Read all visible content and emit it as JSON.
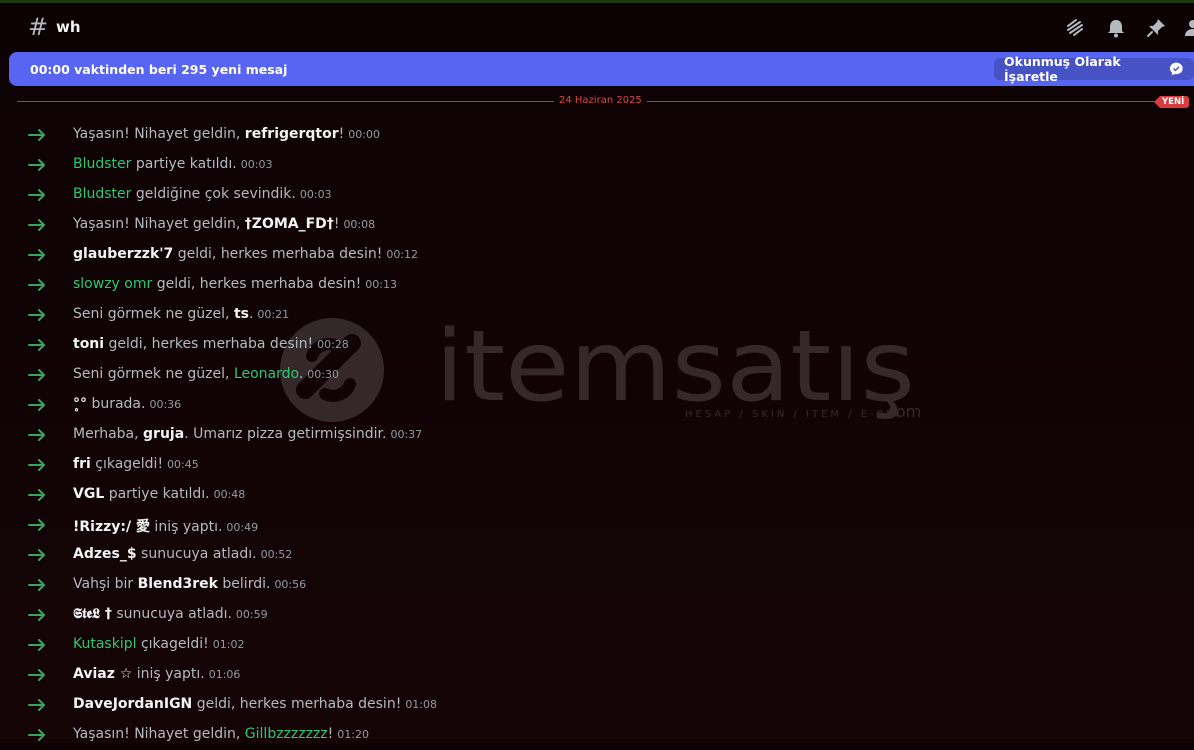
{
  "channel": {
    "name": "wh",
    "hash_icon": "hash-icon"
  },
  "header_icons": [
    "threads-icon",
    "bell-icon",
    "pin-icon",
    "members-icon"
  ],
  "banner": {
    "text": "00:00 vaktinden beri 295 yeni mesaj",
    "mark_read": "Okunmuş Olarak İşaretle",
    "color": "#5865f2"
  },
  "divider": {
    "date": "24 Haziran 2025",
    "badge": "YENİ"
  },
  "watermark": {
    "brand": "itemsatış",
    "tagline": "HESAP / SKIN / ITEM / E-PIN",
    "suffix": ".com"
  },
  "messages": [
    {
      "pre": "Yaşasın! Nihayet geldin, ",
      "user": "refrigerqtor",
      "green": false,
      "post": "!",
      "time": "00:00"
    },
    {
      "pre": "",
      "user": "Bludster",
      "green": true,
      "post": " partiye katıldı.",
      "time": "00:03"
    },
    {
      "pre": "",
      "user": "Bludster",
      "green": true,
      "post": " geldiğine çok sevindik.",
      "time": "00:03"
    },
    {
      "pre": "Yaşasın! Nihayet geldin, ",
      "user": "†ZOMA_FD†",
      "green": false,
      "post": "!",
      "time": "00:08"
    },
    {
      "pre": "",
      "user": "glauberzzk'7",
      "green": false,
      "post": " geldi, herkes merhaba desin!",
      "time": "00:12"
    },
    {
      "pre": "",
      "user": "slowzy omr",
      "green": true,
      "post": " geldi, herkes merhaba desin!",
      "time": "00:13"
    },
    {
      "pre": "Seni görmek ne güzel, ",
      "user": "ts",
      "green": false,
      "post": ".",
      "time": "00:21"
    },
    {
      "pre": "",
      "user": "toni",
      "green": false,
      "post": " geldi, herkes merhaba desin!",
      "time": "00:28"
    },
    {
      "pre": "Seni görmek ne güzel, ",
      "user": "Leonardo",
      "green": true,
      "post": ".",
      "time": "00:30"
    },
    {
      "pre": "",
      "user": "°̥°",
      "green": false,
      "post": " burada.",
      "time": "00:36"
    },
    {
      "pre": "Merhaba, ",
      "user": "gruja",
      "green": false,
      "post": ". Umarız pizza getirmişsindir.",
      "time": "00:37"
    },
    {
      "pre": "",
      "user": "fri",
      "green": false,
      "post": " çıkageldi!",
      "time": "00:45"
    },
    {
      "pre": "",
      "user": "VGL",
      "green": false,
      "post": " partiye katıldı.",
      "time": "00:48"
    },
    {
      "pre": "",
      "user": "!Rizzy:/ 愛",
      "green": false,
      "post": " iniş yaptı.",
      "time": "00:49"
    },
    {
      "pre": "",
      "user": "Adzes_$",
      "green": false,
      "post": " sunucuya atladı.",
      "time": "00:52"
    },
    {
      "pre": "Vahşi bir ",
      "user": "Blend3rek",
      "green": false,
      "post": " belirdi.",
      "time": "00:56"
    },
    {
      "pre": "",
      "user": "𝕾𝖙𝖊𝕷 †",
      "green": false,
      "post": " sunucuya atladı.",
      "time": "00:59"
    },
    {
      "pre": "",
      "user": "Kutaskipl",
      "green": true,
      "post": " çıkageldi!",
      "time": "01:02"
    },
    {
      "pre": "",
      "user": "Aviaz ☆",
      "green": false,
      "post": " iniş yaptı.",
      "time": "01:06"
    },
    {
      "pre": "",
      "user": "DaveJordanIGN",
      "green": false,
      "post": " geldi, herkes merhaba desin!",
      "time": "01:08"
    },
    {
      "pre": "Yaşasın! Nihayet geldin, ",
      "user": "Gillbzzzzzzz",
      "green": true,
      "post": "!",
      "time": "01:20"
    }
  ]
}
